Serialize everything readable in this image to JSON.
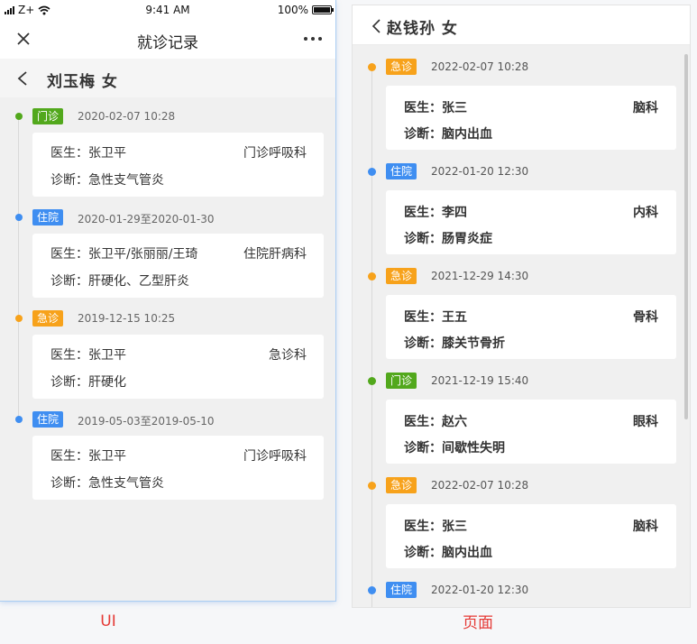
{
  "colors": {
    "green": "#52a81c",
    "blue": "#3f8ef1",
    "orange": "#f7a21b"
  },
  "left": {
    "status": {
      "carrier": "Z+",
      "time": "9:41 AM",
      "battery": "100%"
    },
    "nav": {
      "title": "就诊记录",
      "close_icon": "close-icon",
      "more_icon": "more-icon"
    },
    "patient": {
      "name": "刘玉梅  女"
    },
    "records": [
      {
        "tag": "门诊",
        "color": "green",
        "date": "2020-02-07  10:28",
        "doctor": "医生：张卫平",
        "dept": "门诊呼吸科",
        "diagnosis": "诊断：急性支气管炎"
      },
      {
        "tag": "住院",
        "color": "blue",
        "date": "2020-01-29至2020-01-30",
        "doctor": "医生：张卫平/张丽丽/王琦",
        "dept": "住院肝病科",
        "diagnosis": "诊断：肝硬化、乙型肝炎"
      },
      {
        "tag": "急诊",
        "color": "orange",
        "date": "2019-12-15 10:25",
        "doctor": "医生：张卫平",
        "dept": "急诊科",
        "diagnosis": "诊断：肝硬化"
      },
      {
        "tag": "住院",
        "color": "blue",
        "date": "2019-05-03至2019-05-10",
        "doctor": "医生：张卫平",
        "dept": "门诊呼吸科",
        "diagnosis": "诊断：急性支气管炎"
      }
    ],
    "caption": "UI"
  },
  "right": {
    "header": {
      "title": "赵钱孙 女"
    },
    "records": [
      {
        "tag": "急诊",
        "color": "orange",
        "date": "2022-02-07 10:28",
        "doctor": "医生：张三",
        "dept": "脑科",
        "diagnosis": "诊断：脑内出血"
      },
      {
        "tag": "住院",
        "color": "blue",
        "date": "2022-01-20 12:30",
        "doctor": "医生：李四",
        "dept": "内科",
        "diagnosis": "诊断：肠胃炎症"
      },
      {
        "tag": "急诊",
        "color": "orange",
        "date": "2021-12-29 14:30",
        "doctor": "医生：王五",
        "dept": "骨科",
        "diagnosis": "诊断：膝关节骨折"
      },
      {
        "tag": "门诊",
        "color": "green",
        "date": "2021-12-19 15:40",
        "doctor": "医生：赵六",
        "dept": "眼科",
        "diagnosis": "诊断：间歇性失明"
      },
      {
        "tag": "急诊",
        "color": "orange",
        "date": "2022-02-07 10:28",
        "doctor": "医生：张三",
        "dept": "脑科",
        "diagnosis": "诊断：脑内出血"
      },
      {
        "tag": "住院",
        "color": "blue",
        "date": "2022-01-20 12:30",
        "doctor": "",
        "dept": "",
        "diagnosis": ""
      }
    ],
    "caption": "页面"
  }
}
